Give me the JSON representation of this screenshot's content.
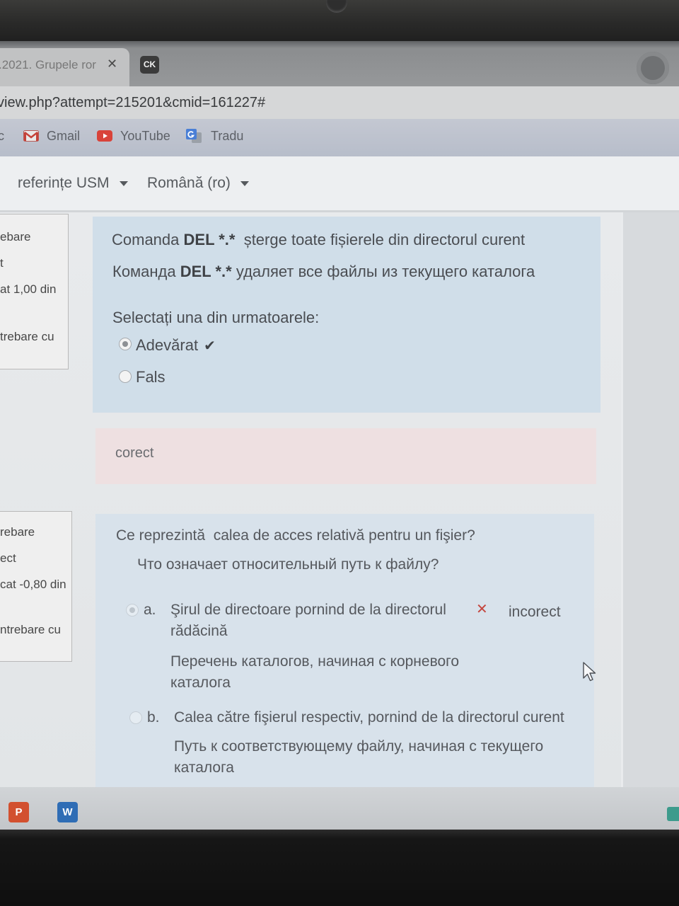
{
  "browser": {
    "active_tab": {
      "title": ".2021. Grupele ror",
      "close_glyph": "✕"
    },
    "second_tab": {
      "favicon_text": "CK"
    },
    "address_bar": {
      "url": "view.php?attempt=215201&cmid=161227#"
    },
    "bookmarks": [
      {
        "label": "c"
      },
      {
        "label": "Gmail",
        "icon": "gmail-icon"
      },
      {
        "label": "YouTube",
        "icon": "youtube-icon"
      },
      {
        "label": "Tradu",
        "icon": "translate-icon"
      }
    ]
  },
  "navbar": {
    "menus": [
      {
        "label": "referințe USM",
        "icon": "caret-down-icon"
      },
      {
        "label": "Română (ro)",
        "icon": "caret-down-icon"
      }
    ]
  },
  "quiz": {
    "questions": [
      {
        "info": [
          "ebare",
          "t",
          "at 1,00 din",
          "trebare cu"
        ],
        "text_ro": {
          "before": "Comanda ",
          "bold": "DEL *.*",
          "after": "  șterge toate fișierele din directorul curent"
        },
        "text_ru": {
          "before": "Команда ",
          "bold": "DEL *.*",
          "after": " удаляет все файлы из текущего каталога"
        },
        "prompt": "Selectați una din urmatoarele:",
        "options": [
          {
            "label": "Adevărat",
            "selected": true,
            "mark_glyph": "✔",
            "mark_icon": "check-icon"
          },
          {
            "label": "Fals",
            "selected": false
          }
        ],
        "feedback": "corect"
      },
      {
        "info": [
          "rebare",
          "ect",
          "cat -0,80 din",
          "ntrebare cu"
        ],
        "text_ro": "Ce reprezintă  calea de acces relativă pentru un fişier?",
        "text_ru": "Что означает относительный путь к файлу?",
        "options": [
          {
            "letter": "a.",
            "text_ro": "Şirul de directoare pornind de la directorul rădăcină",
            "text_ru": "Перечень каталогов, начиная с корневого каталога",
            "selected": true,
            "mark_glyph": "✕",
            "mark_icon": "cross-icon",
            "status": "incorect"
          },
          {
            "letter": "b.",
            "text_ro": "Calea către fişierul respectiv, pornind de la directorul curent",
            "text_ru": "Путь к соответствующему файлу, начиная с текущего каталога",
            "selected": false
          }
        ]
      }
    ]
  },
  "taskbar": {
    "apps": [
      {
        "icon": "powerpoint-icon",
        "glyph": "P"
      },
      {
        "icon": "word-icon",
        "glyph": "W"
      },
      {
        "icon": "app-icon"
      }
    ]
  },
  "colors": {
    "question_bg": "#d0dee9",
    "question2_bg": "#d8e2eb",
    "feedback_bg": "#eee0e1",
    "incorrect": "#c4473f",
    "correct_check": "#404347",
    "powerpoint": "#d2502f",
    "word": "#2f6db5"
  }
}
